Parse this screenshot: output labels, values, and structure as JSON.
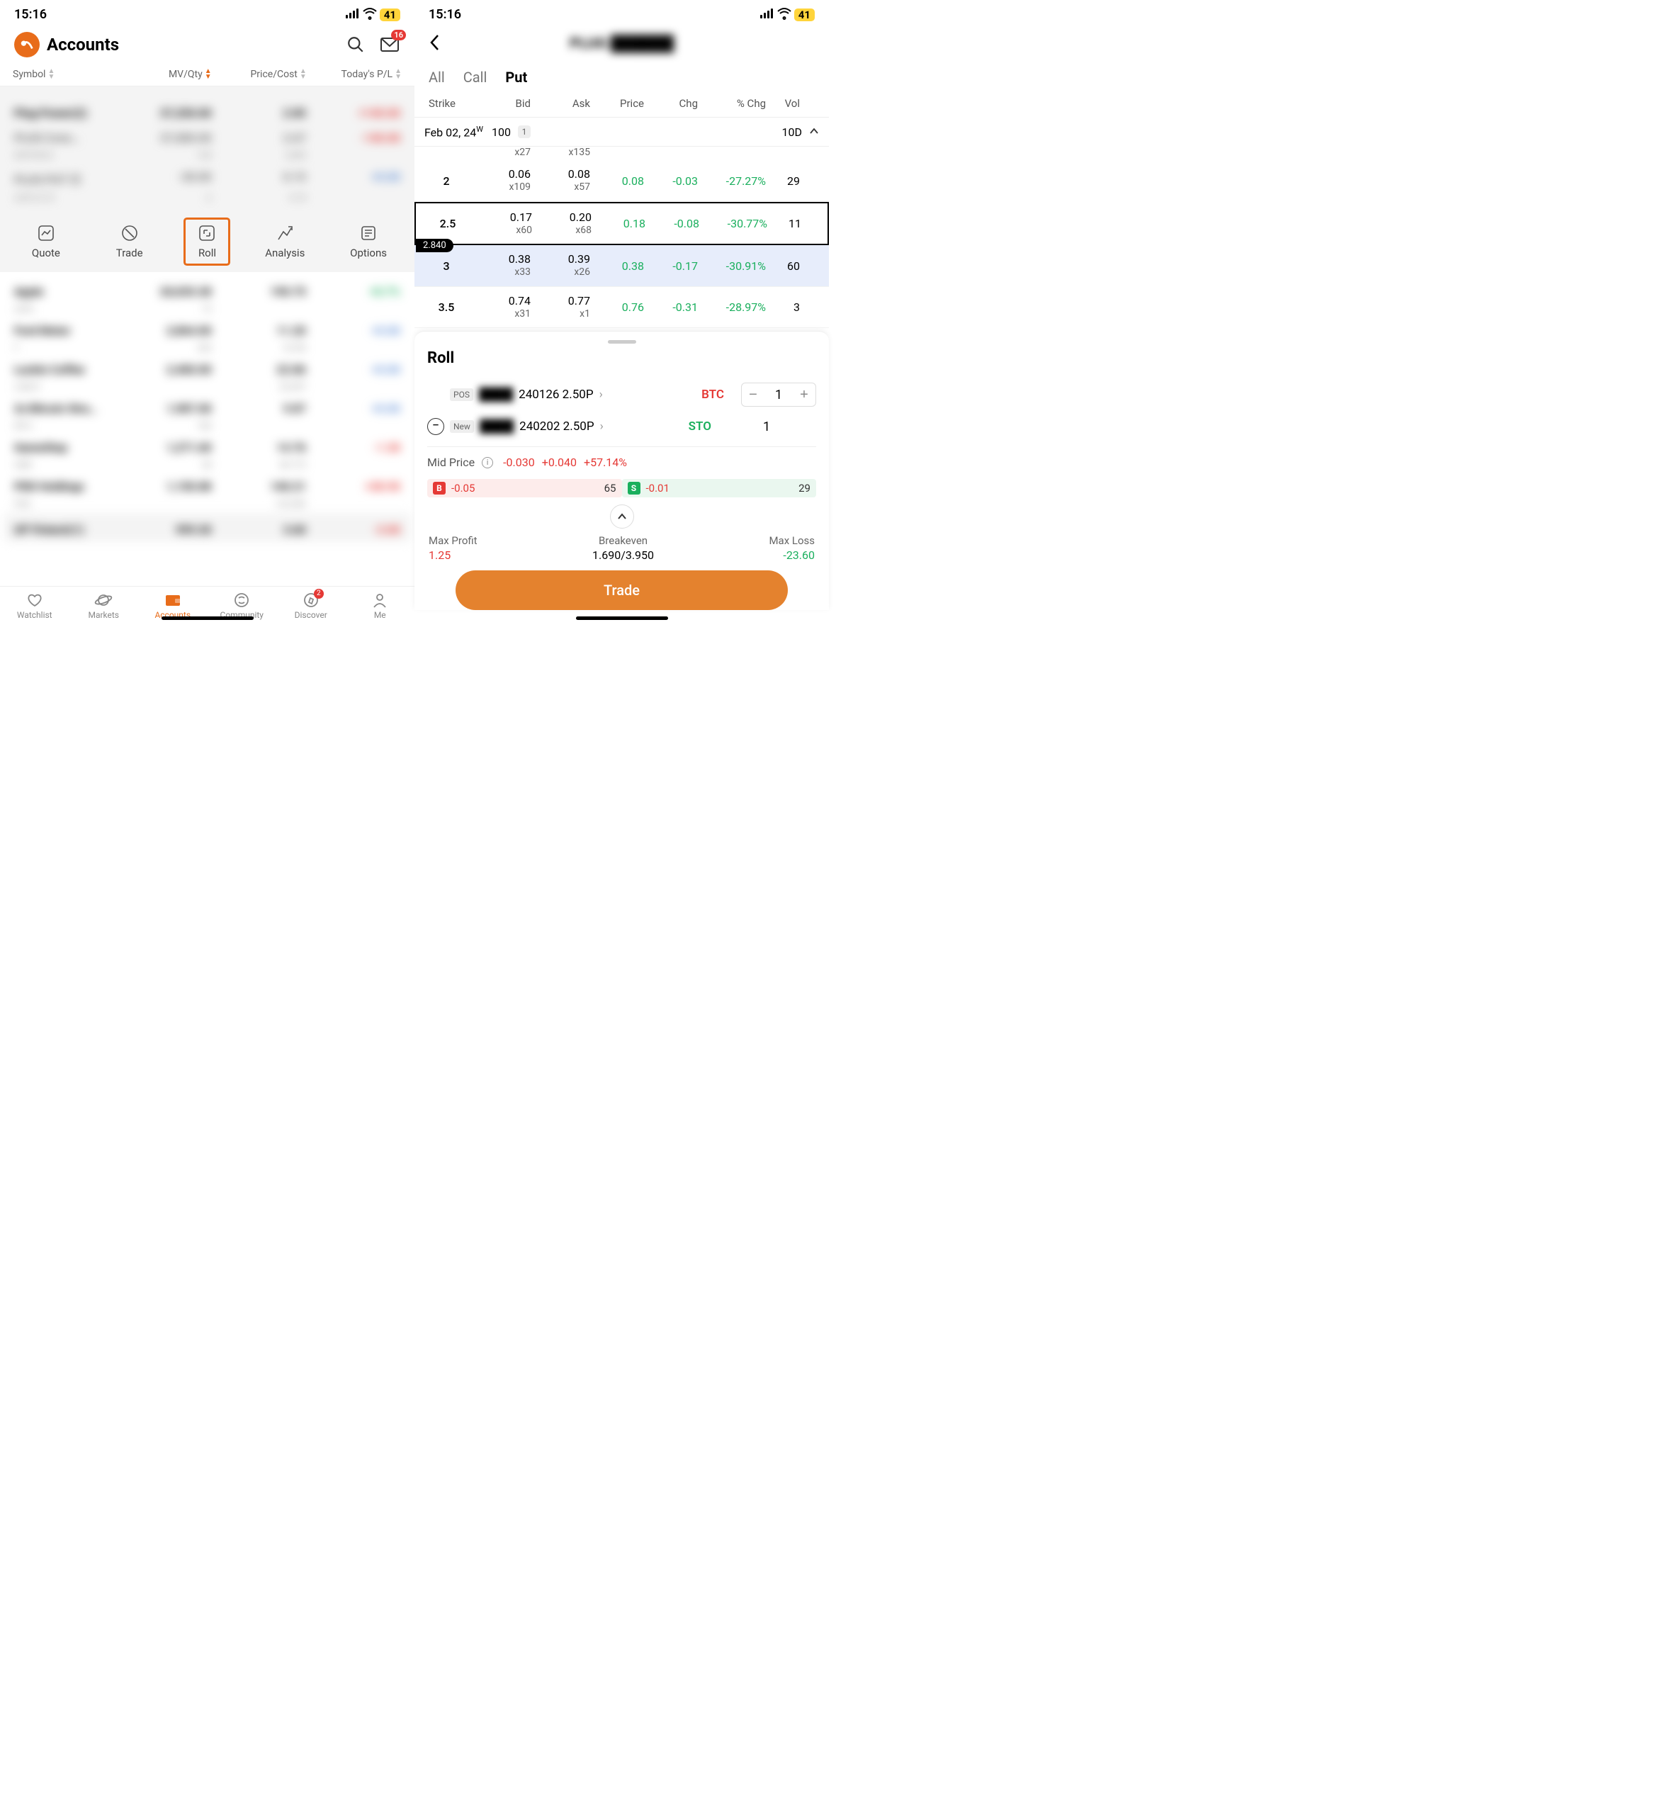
{
  "status": {
    "time": "15:16",
    "battery": "41"
  },
  "header": {
    "title": "Accounts",
    "inbox_badge": "16"
  },
  "columns": [
    "Symbol",
    "MV/Qty",
    "Price/Cost",
    "Today's P/L"
  ],
  "actions": [
    {
      "label": "Quote"
    },
    {
      "label": "Trade"
    },
    {
      "label": "Roll"
    },
    {
      "label": "Analysis"
    },
    {
      "label": "Options"
    }
  ],
  "bottom_nav": [
    {
      "label": "Watchlist"
    },
    {
      "label": "Markets"
    },
    {
      "label": "Accounts"
    },
    {
      "label": "Community"
    },
    {
      "label": "Discover",
      "badge": "2"
    },
    {
      "label": "Me"
    }
  ],
  "chain": {
    "tabs": [
      "All",
      "Call",
      "Put"
    ],
    "headers": [
      "Strike",
      "Bid",
      "Ask",
      "Price",
      "Chg",
      "% Chg",
      "Vol"
    ],
    "expiry": {
      "date": "Feb 02, 24",
      "weekly": "W",
      "mult": "100",
      "badge": "1",
      "dte": "10D"
    },
    "peek": {
      "bid_sz": "x27",
      "ask_sz": "x135"
    },
    "spot": "2.840",
    "rows": [
      {
        "strike": "2",
        "bid": "0.06",
        "bid_sz": "x109",
        "ask": "0.08",
        "ask_sz": "x57",
        "price": "0.08",
        "chg": "-0.03",
        "pch": "-27.27%",
        "vol": "29"
      },
      {
        "strike": "2.5",
        "bid": "0.17",
        "bid_sz": "x60",
        "ask": "0.20",
        "ask_sz": "x68",
        "price": "0.18",
        "chg": "-0.08",
        "pch": "-30.77%",
        "vol": "11"
      },
      {
        "strike": "3",
        "bid": "0.38",
        "bid_sz": "x33",
        "ask": "0.39",
        "ask_sz": "x26",
        "price": "0.38",
        "chg": "-0.17",
        "pch": "-30.91%",
        "vol": "60"
      },
      {
        "strike": "3.5",
        "bid": "0.74",
        "bid_sz": "x31",
        "ask": "0.77",
        "ask_sz": "x1",
        "price": "0.76",
        "chg": "-0.31",
        "pch": "-28.97%",
        "vol": "3"
      }
    ]
  },
  "roll": {
    "title": "Roll",
    "pos_tag": "POS",
    "pos_detail": "240126 2.50P",
    "pos_side": "BTC",
    "pos_qty": "1",
    "new_tag": "New",
    "new_detail": "240202 2.50P",
    "new_side": "STO",
    "new_qty": "1",
    "mid_label": "Mid Price",
    "mid_v1": "-0.030",
    "mid_v2": "+0.040",
    "mid_v3": "+57.14%",
    "b_chip": "B",
    "b_price": "-0.05",
    "b_size": "65",
    "s_chip": "S",
    "s_price": "-0.01",
    "s_size": "29",
    "stats": {
      "profit_lbl": "Max Profit",
      "profit_val": "1.25",
      "be_lbl": "Breakeven",
      "be_val": "1.690/3.950",
      "loss_lbl": "Max Loss",
      "loss_val": "-23.60"
    },
    "trade_btn": "Trade"
  },
  "chevron": "›"
}
